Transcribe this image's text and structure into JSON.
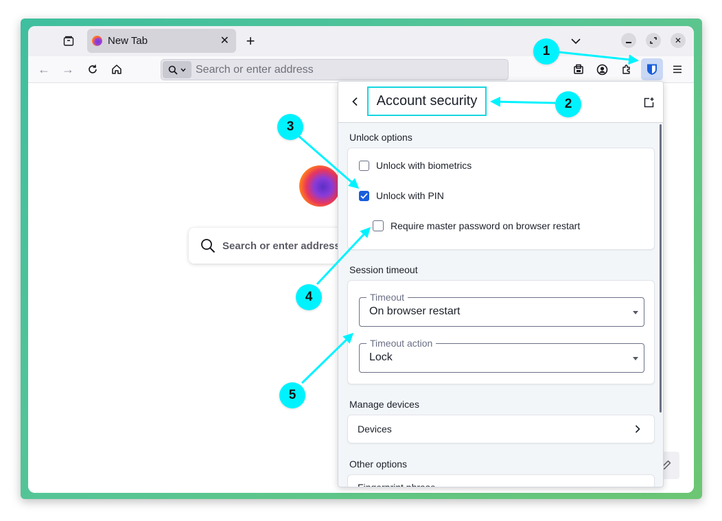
{
  "browser": {
    "tab": {
      "title": "New Tab"
    },
    "address_bar": {
      "placeholder": "Search or enter address"
    },
    "home_search": {
      "text": "Search or enter address"
    }
  },
  "popup": {
    "title": "Account security",
    "sections": {
      "unlock_options": {
        "label": "Unlock options",
        "options": [
          {
            "label": "Unlock with biometrics",
            "checked": false
          },
          {
            "label": "Unlock with PIN",
            "checked": true
          },
          {
            "label": "Require master password on browser restart",
            "checked": false
          }
        ]
      },
      "session_timeout": {
        "label": "Session timeout",
        "timeout": {
          "legend": "Timeout",
          "value": "On browser restart"
        },
        "timeout_action": {
          "legend": "Timeout action",
          "value": "Lock"
        }
      },
      "manage_devices": {
        "label": "Manage devices",
        "devices_label": "Devices"
      },
      "other_options": {
        "label": "Other options",
        "first_item": "Fingerprint phrase"
      }
    }
  },
  "annotations": {
    "badges": [
      "1",
      "2",
      "3",
      "4",
      "5"
    ],
    "color": "#00f2ff"
  },
  "colors": {
    "accent": "#175ddc",
    "desktop_bg": "#56c596",
    "annotation_box": "#15d6e0"
  }
}
